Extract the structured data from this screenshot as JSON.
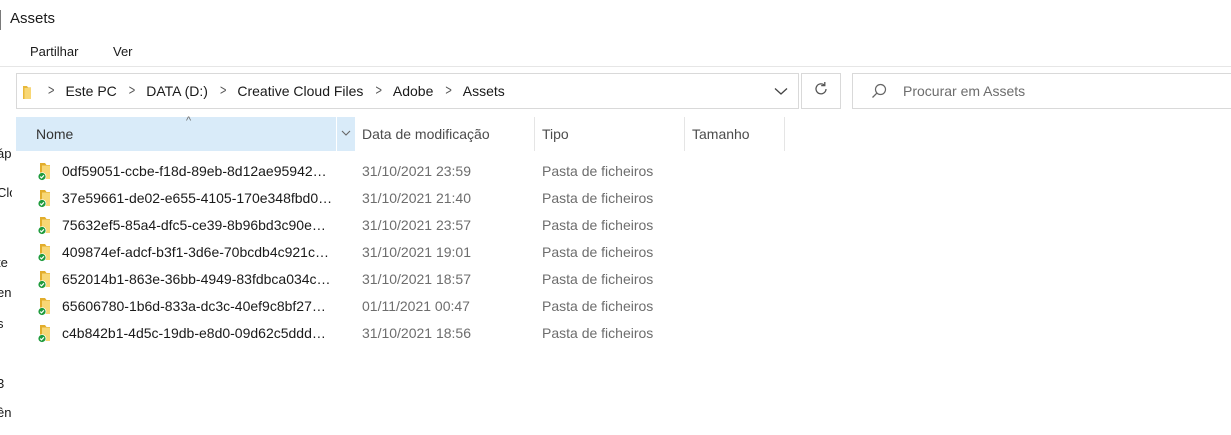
{
  "window": {
    "title": "Assets"
  },
  "ribbon": {
    "tabs": [
      "Partilhar",
      "Ver"
    ]
  },
  "address": {
    "breadcrumbs": [
      "Este PC",
      "DATA (D:)",
      "Creative Cloud Files",
      "Adobe",
      "Assets"
    ]
  },
  "search": {
    "placeholder": "Procurar em Assets"
  },
  "nav_pane": {
    "fragments": [
      "áp",
      "Clo",
      "te",
      "en",
      "s",
      "3",
      "ên"
    ]
  },
  "columns": {
    "name": "Nome",
    "date": "Data de modificação",
    "type": "Tipo",
    "size": "Tamanho"
  },
  "sort": {
    "column": "name",
    "direction": "ascending"
  },
  "files": [
    {
      "name": "0df59051-ccbe-f18d-89eb-8d12ae95942…",
      "date": "31/10/2021 23:59",
      "type": "Pasta de ficheiros",
      "size": "",
      "sync": "synced"
    },
    {
      "name": "37e59661-de02-e655-4105-170e348fbd0…",
      "date": "31/10/2021 21:40",
      "type": "Pasta de ficheiros",
      "size": "",
      "sync": "synced"
    },
    {
      "name": "75632ef5-85a4-dfc5-ce39-8b96bd3c90e…",
      "date": "31/10/2021 23:57",
      "type": "Pasta de ficheiros",
      "size": "",
      "sync": "synced"
    },
    {
      "name": "409874ef-adcf-b3f1-3d6e-70bcdb4c921c…",
      "date": "31/10/2021 19:01",
      "type": "Pasta de ficheiros",
      "size": "",
      "sync": "synced"
    },
    {
      "name": "652014b1-863e-36bb-4949-83fdbca034c…",
      "date": "31/10/2021 18:57",
      "type": "Pasta de ficheiros",
      "size": "",
      "sync": "synced"
    },
    {
      "name": "65606780-1b6d-833a-dc3c-40ef9c8bf27…",
      "date": "01/11/2021 00:47",
      "type": "Pasta de ficheiros",
      "size": "",
      "sync": "synced"
    },
    {
      "name": "c4b842b1-4d5c-19db-e8d0-09d62c5ddd…",
      "date": "31/10/2021 18:56",
      "type": "Pasta de ficheiros",
      "size": "",
      "sync": "synced"
    }
  ],
  "colors": {
    "header_selected": "#d9ebf9",
    "folder": "#f8d775",
    "sync_green": "#1e9b3d"
  },
  "icons": {
    "folder": "folder-icon",
    "sync": "sync-check-icon",
    "refresh": "refresh-icon",
    "search": "search-icon",
    "chevron": "chevron-right-icon",
    "dropdown": "chevron-down-icon"
  }
}
